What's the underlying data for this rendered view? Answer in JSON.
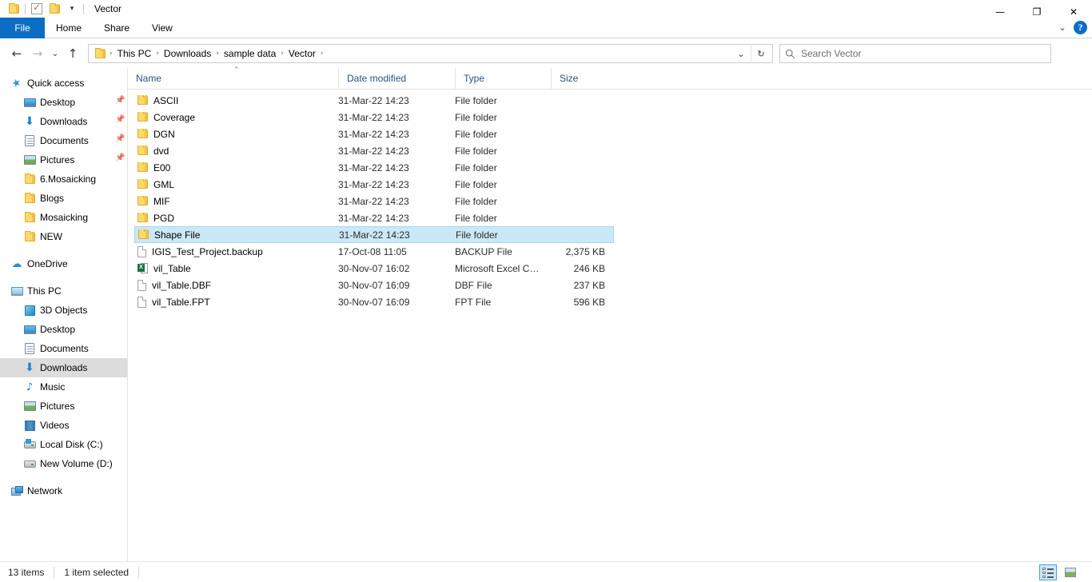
{
  "window": {
    "title": "Vector",
    "quick_access_toolbar": [
      {
        "name": "folder-icon",
        "label": ""
      },
      {
        "name": "properties-icon",
        "label": ""
      },
      {
        "name": "new-folder-icon",
        "label": ""
      },
      {
        "name": "customize-dropdown-icon",
        "label": "▾"
      }
    ],
    "controls": {
      "minimize": "—",
      "maximize": "❐",
      "close": "✕",
      "ribbon_collapse": "⌄",
      "help": "?"
    }
  },
  "ribbon": {
    "tabs": [
      {
        "label": "File",
        "active": true
      },
      {
        "label": "Home",
        "active": false
      },
      {
        "label": "Share",
        "active": false
      },
      {
        "label": "View",
        "active": false
      }
    ]
  },
  "navigation": {
    "back": "←",
    "forward": "→",
    "recent": "⌄",
    "up": "↑",
    "breadcrumbs": [
      "This PC",
      "Downloads",
      "sample data",
      "Vector"
    ],
    "breadcrumb_separator": "›",
    "address_dropdown": "⌄",
    "refresh": "↻"
  },
  "search": {
    "placeholder": "Search Vector",
    "value": ""
  },
  "sidebar": {
    "groups": [
      {
        "header": {
          "label": "Quick access",
          "icon": "star-icon"
        },
        "items": [
          {
            "label": "Desktop",
            "icon": "desktop-icon",
            "pinned": true,
            "indent": 1
          },
          {
            "label": "Downloads",
            "icon": "download-icon",
            "pinned": true,
            "indent": 1
          },
          {
            "label": "Documents",
            "icon": "documents-icon",
            "pinned": true,
            "indent": 1
          },
          {
            "label": "Pictures",
            "icon": "pictures-icon",
            "pinned": true,
            "indent": 1
          },
          {
            "label": "6.Mosaicking",
            "icon": "folder-icon",
            "pinned": false,
            "indent": 1
          },
          {
            "label": "Blogs",
            "icon": "folder-icon",
            "pinned": false,
            "indent": 1
          },
          {
            "label": "Mosaicking",
            "icon": "folder-icon",
            "pinned": false,
            "indent": 1
          },
          {
            "label": "NEW",
            "icon": "folder-icon",
            "pinned": false,
            "indent": 1
          }
        ]
      },
      {
        "header": {
          "label": "OneDrive",
          "icon": "cloud-icon"
        },
        "items": []
      },
      {
        "header": {
          "label": "This PC",
          "icon": "this-pc-icon"
        },
        "items": [
          {
            "label": "3D Objects",
            "icon": "3d-objects-icon",
            "indent": 1,
            "selected": false
          },
          {
            "label": "Desktop",
            "icon": "desktop-icon",
            "indent": 1,
            "selected": false
          },
          {
            "label": "Documents",
            "icon": "documents-icon",
            "indent": 1,
            "selected": false
          },
          {
            "label": "Downloads",
            "icon": "download-icon",
            "indent": 1,
            "selected": true
          },
          {
            "label": "Music",
            "icon": "music-icon",
            "indent": 1,
            "selected": false
          },
          {
            "label": "Pictures",
            "icon": "pictures-icon",
            "indent": 1,
            "selected": false
          },
          {
            "label": "Videos",
            "icon": "videos-icon",
            "indent": 1,
            "selected": false
          },
          {
            "label": "Local Disk (C:)",
            "icon": "windows-disk-icon",
            "indent": 1,
            "selected": false
          },
          {
            "label": "New Volume (D:)",
            "icon": "disk-icon",
            "indent": 1,
            "selected": false
          }
        ]
      },
      {
        "header": {
          "label": "Network",
          "icon": "network-icon"
        },
        "items": []
      }
    ]
  },
  "file_list": {
    "columns": [
      {
        "label": "Name",
        "sorted": true,
        "sort_direction": "asc"
      },
      {
        "label": "Date modified",
        "sorted": false
      },
      {
        "label": "Type",
        "sorted": false
      },
      {
        "label": "Size",
        "sorted": false
      }
    ],
    "sort_caret": "⌃",
    "rows": [
      {
        "name": "ASCII",
        "date": "31-Mar-22 14:23",
        "type": "File folder",
        "size": "",
        "icon": "folder-icon",
        "selected": false
      },
      {
        "name": "Coverage",
        "date": "31-Mar-22 14:23",
        "type": "File folder",
        "size": "",
        "icon": "folder-icon",
        "selected": false
      },
      {
        "name": "DGN",
        "date": "31-Mar-22 14:23",
        "type": "File folder",
        "size": "",
        "icon": "folder-icon",
        "selected": false
      },
      {
        "name": "dvd",
        "date": "31-Mar-22 14:23",
        "type": "File folder",
        "size": "",
        "icon": "folder-icon",
        "selected": false
      },
      {
        "name": "E00",
        "date": "31-Mar-22 14:23",
        "type": "File folder",
        "size": "",
        "icon": "folder-icon",
        "selected": false
      },
      {
        "name": "GML",
        "date": "31-Mar-22 14:23",
        "type": "File folder",
        "size": "",
        "icon": "folder-icon",
        "selected": false
      },
      {
        "name": "MIF",
        "date": "31-Mar-22 14:23",
        "type": "File folder",
        "size": "",
        "icon": "folder-icon",
        "selected": false
      },
      {
        "name": "PGD",
        "date": "31-Mar-22 14:23",
        "type": "File folder",
        "size": "",
        "icon": "folder-icon",
        "selected": false
      },
      {
        "name": "Shape File",
        "date": "31-Mar-22 14:23",
        "type": "File folder",
        "size": "",
        "icon": "folder-icon",
        "selected": true
      },
      {
        "name": "IGIS_Test_Project.backup",
        "date": "17-Oct-08 11:05",
        "type": "BACKUP File",
        "size": "2,375 KB",
        "icon": "file-icon",
        "selected": false
      },
      {
        "name": "vil_Table",
        "date": "30-Nov-07 16:02",
        "type": "Microsoft Excel C…",
        "size": "246 KB",
        "icon": "excel-icon",
        "selected": false
      },
      {
        "name": "vil_Table.DBF",
        "date": "30-Nov-07 16:09",
        "type": "DBF File",
        "size": "237 KB",
        "icon": "file-icon",
        "selected": false
      },
      {
        "name": "vil_Table.FPT",
        "date": "30-Nov-07 16:09",
        "type": "FPT File",
        "size": "596 KB",
        "icon": "file-icon",
        "selected": false
      }
    ]
  },
  "status_bar": {
    "item_count": "13 items",
    "selection": "1 item selected",
    "views": [
      {
        "name": "details-view",
        "active": true
      },
      {
        "name": "large-icons-view",
        "active": false
      }
    ]
  },
  "colors": {
    "accent": "#0b6ec4",
    "selection": "#cbe8f6",
    "selection_border": "#a6d6ef",
    "nav_selected": "#dcdcdc",
    "header_text": "#28537e",
    "folder": "#fbd96b"
  }
}
